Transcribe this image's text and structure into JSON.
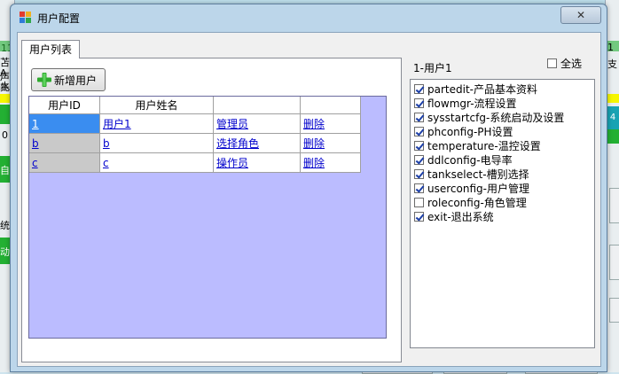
{
  "dialog": {
    "title": "用户配置",
    "close_label": "✕"
  },
  "tabs": [
    {
      "label": "用户列表"
    }
  ],
  "toolbar": {
    "add_user_label": "新增用户"
  },
  "grid": {
    "columns": [
      "用户ID",
      "用户姓名"
    ],
    "rows": [
      {
        "id": "1",
        "name": "用户1",
        "role": "管理员",
        "action": "删除"
      },
      {
        "id": "b",
        "name": "b",
        "role": "选择角色",
        "action": "删除"
      },
      {
        "id": "c",
        "name": "c",
        "role": "操作员",
        "action": "删除"
      }
    ]
  },
  "permissions": {
    "title": "1-用户1",
    "select_all_label": "全选",
    "select_all_checked": false,
    "items": [
      {
        "label": "partedit-产品基本资料",
        "checked": true
      },
      {
        "label": "flowmgr-流程设置",
        "checked": true
      },
      {
        "label": "sysstartcfg-系统启动及设置",
        "checked": true
      },
      {
        "label": "phconfig-PH设置",
        "checked": true
      },
      {
        "label": "temperature-温控设置",
        "checked": true
      },
      {
        "label": "ddlconfig-电导率",
        "checked": true
      },
      {
        "label": "tankselect-槽别选择",
        "checked": true
      },
      {
        "label": "userconfig-用户管理",
        "checked": true
      },
      {
        "label": "roleconfig-角色管理",
        "checked": false
      },
      {
        "label": "exit-退出系统",
        "checked": true
      }
    ]
  },
  "background": {
    "left_texts": [
      "11",
      "苫声",
      "A水",
      "先1",
      "0",
      "自",
      "统",
      "动"
    ],
    "right_texts": [
      "1",
      "支",
      "4",
      "0"
    ]
  },
  "colors": {
    "grid_bg": "#bbbcff",
    "selected_cell": "#3a8df0",
    "link": "#0000cc",
    "checkmark": "#1c3fa8"
  }
}
